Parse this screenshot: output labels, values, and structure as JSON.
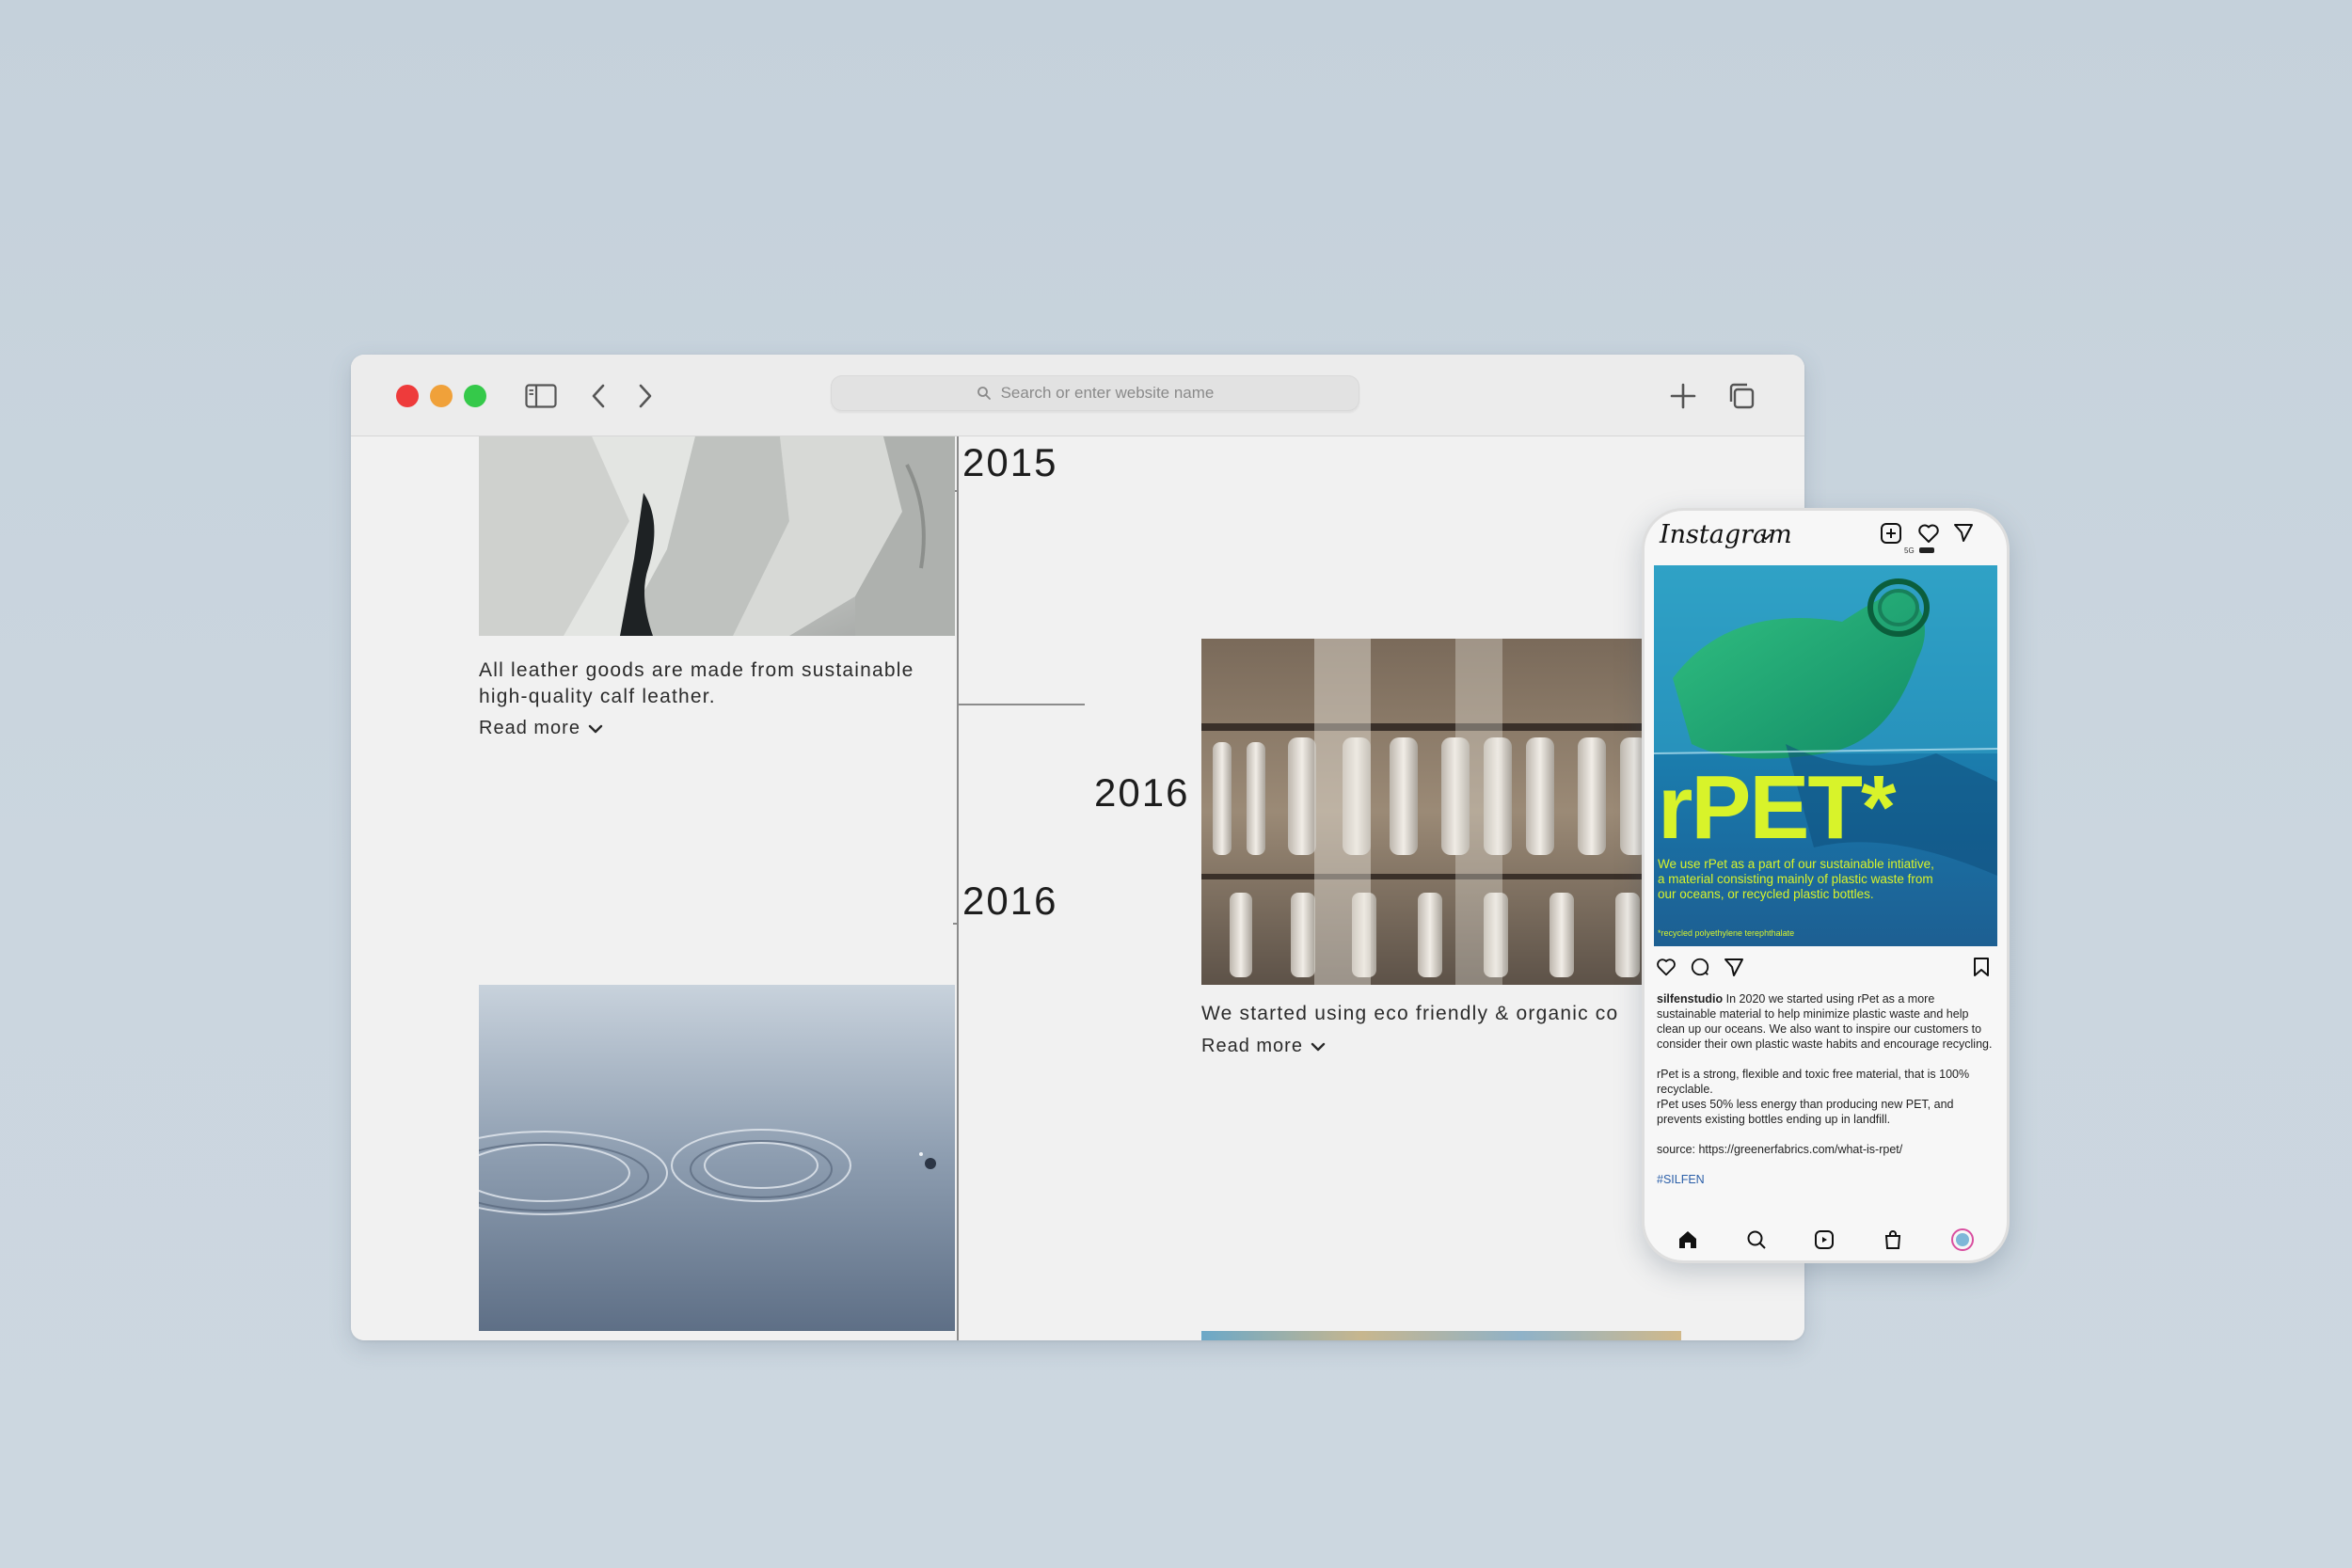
{
  "browser": {
    "address_placeholder": "Search or enter website name",
    "timeline": {
      "items": [
        {
          "year": "2015",
          "caption_line1": "All leather goods are made from sustainable",
          "caption_line2": "high-quality calf leather.",
          "read_more": "Read more"
        },
        {
          "year": "2016",
          "caption_line1": "We started using eco friendly & organic co",
          "read_more": "Read more"
        },
        {
          "year": "2016"
        }
      ]
    }
  },
  "phone": {
    "app_name": "Instagram",
    "status": "5G",
    "post": {
      "headline": "rPET*",
      "body": "We use rPet as a part of our sustainable intiative, a material consisting mainly of plastic waste from our oceans, or recycled plastic bottles.",
      "footnote": "*recycled polyethylene terephthalate"
    },
    "caption": {
      "username": "silfenstudio",
      "p1": "In 2020 we started using rPet as a more sustainable material to help minimize plastic waste and help clean up our oceans. We also want to inspire our customers to consider their own plastic waste habits and encourage recycling.",
      "p2": "rPet is a strong, flexible and toxic free material, that is 100% recyclable.",
      "p3": "rPet uses 50% less energy than producing new PET, and prevents existing bottles ending up in landfill.",
      "source": "source: https://greenerfabrics.com/what-is-rpet/",
      "hashtag": "#SILFEN"
    }
  },
  "colors": {
    "accent_yellow": "#d8f32a",
    "close": "#ee3b3b",
    "minimize": "#f0a13a",
    "maximize": "#35c94a"
  }
}
